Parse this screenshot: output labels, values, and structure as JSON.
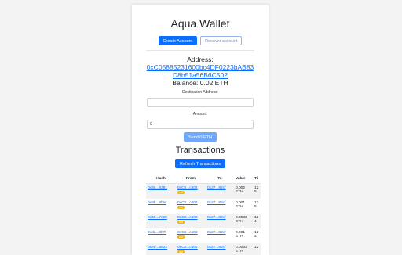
{
  "app": {
    "title": "Aqua Wallet",
    "create_account_label": "Create Account",
    "recover_account_label": "Recover account"
  },
  "account": {
    "address_label": "Address:",
    "address": "0xC05885231600bc4DF0223bAB83D8b51a56B6C502",
    "balance_text": "Balance: 0.02 ETH"
  },
  "send_form": {
    "destination_label": "Destination Address:",
    "destination_value": "",
    "amount_label": "Amount:",
    "amount_value": "0",
    "send_button_label": "Send 0 ETH"
  },
  "transactions": {
    "title": "Transactions",
    "refresh_label": "Refresh Transactions",
    "columns": [
      "Hash",
      "From",
      "To",
      "Value",
      "Ti"
    ],
    "rows": [
      {
        "hash": "0x36...8281",
        "from": "0xC0...c502",
        "badge": "out",
        "to": "0x27...82cf",
        "value": "0.002 ETH",
        "time": "12 5"
      },
      {
        "hash": "0x8b...8f3e",
        "from": "0xC0...c502",
        "badge": "out",
        "to": "0x27...82cf",
        "value": "0.001 ETH",
        "time": "12 5"
      },
      {
        "hash": "0x40...7c29",
        "from": "0xC0...c502",
        "badge": "out",
        "to": "0x27...82cf",
        "value": "0.0033 ETH",
        "time": "12 4"
      },
      {
        "hash": "0xda...9b7f",
        "from": "0xC0...c502",
        "badge": "out",
        "to": "0x27...82cf",
        "value": "0.001 ETH",
        "time": "12 4"
      },
      {
        "hash": "0xed...a622",
        "from": "0xC0...c502",
        "badge": "out",
        "to": "0x27...82cf",
        "value": "0.0033 ETH",
        "time": "12"
      }
    ]
  },
  "colors": {
    "primary": "#0d6efd",
    "badge": "#f5b400",
    "page_background": "#f3f3f3"
  }
}
